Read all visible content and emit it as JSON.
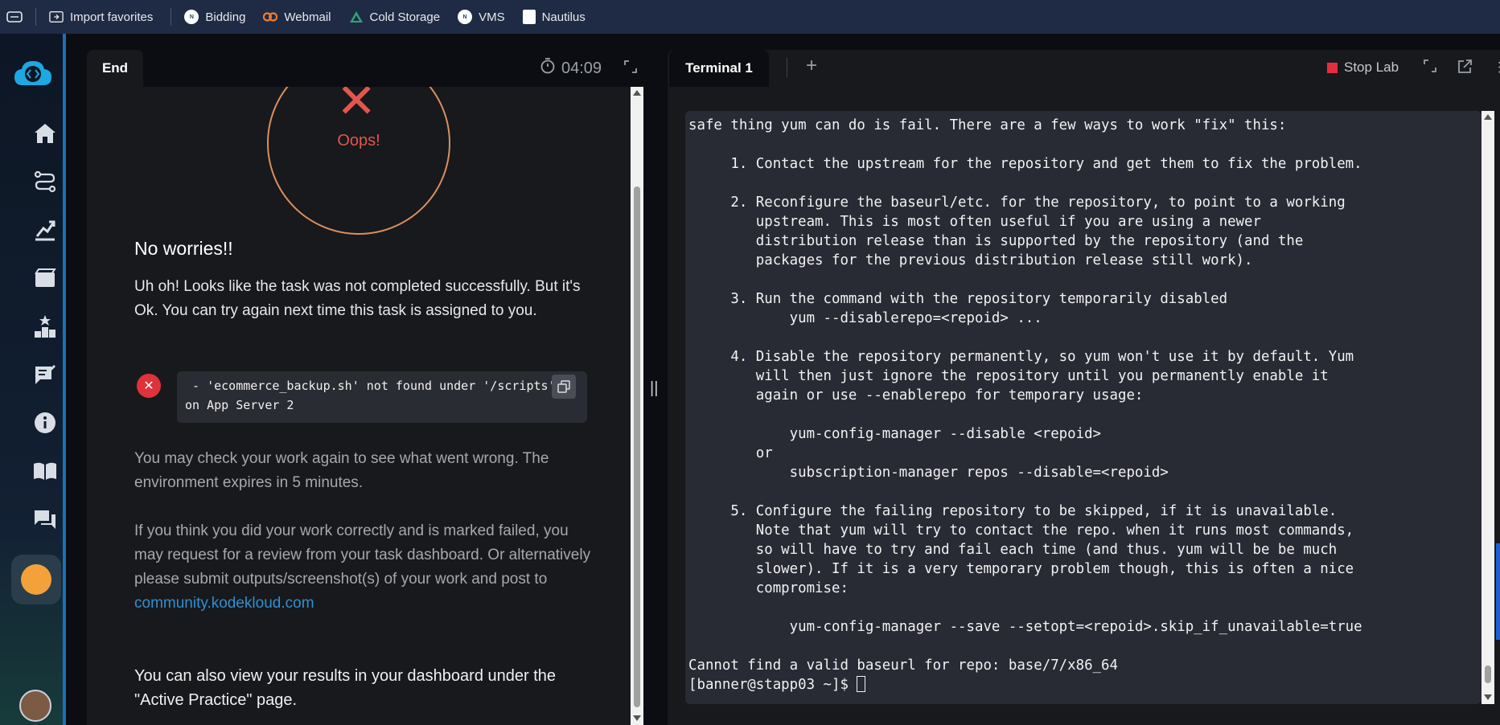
{
  "bookmarks": {
    "items": [
      {
        "label": "Import favorites",
        "icon": "folder-import-icon"
      },
      {
        "label": "Bidding",
        "icon": "nabl-icon"
      },
      {
        "label": "Webmail",
        "icon": "webmail-icon"
      },
      {
        "label": "Cold Storage",
        "icon": "triangle-icon"
      },
      {
        "label": "VMS",
        "icon": "nabl-icon"
      },
      {
        "label": "Nautilus",
        "icon": "page-icon"
      }
    ]
  },
  "left_panel": {
    "tab_label": "End",
    "timer": "04:09",
    "oops": "Oops!",
    "title": "No worries!!",
    "message": "Uh oh! Looks like the task was not completed successfully. But it's Ok. You can try again next time this task is assigned to you.",
    "error_line1": " - 'ecommerce_backup.sh' not found under '/scripts'",
    "error_line2": "on App Server 2",
    "check_again": "You may check your work again to see what went wrong. The environment expires in 5 minutes.",
    "review_text": "If you think you did your work correctly and is marked failed, you may request for a review from your task dashboard. Or alternatively please submit outputs/screenshot(s) of your work and post to ",
    "review_link": "community.kodekloud.com",
    "dashboard_text": "You can also view your results in your dashboard under the \"Active Practice\" page."
  },
  "right_panel": {
    "tab_label": "Terminal 1",
    "stop_label": "Stop Lab",
    "terminal_lines": [
      "safe thing yum can do is fail. There are a few ways to work \"fix\" this:",
      "",
      "     1. Contact the upstream for the repository and get them to fix the problem.",
      "",
      "     2. Reconfigure the baseurl/etc. for the repository, to point to a working",
      "        upstream. This is most often useful if you are using a newer",
      "        distribution release than is supported by the repository (and the",
      "        packages for the previous distribution release still work).",
      "",
      "     3. Run the command with the repository temporarily disabled",
      "            yum --disablerepo=<repoid> ...",
      "",
      "     4. Disable the repository permanently, so yum won't use it by default. Yum",
      "        will then just ignore the repository until you permanently enable it",
      "        again or use --enablerepo for temporary usage:",
      "",
      "            yum-config-manager --disable <repoid>",
      "        or",
      "            subscription-manager repos --disable=<repoid>",
      "",
      "     5. Configure the failing repository to be skipped, if it is unavailable.",
      "        Note that yum will try to contact the repo. when it runs most commands,",
      "        so will have to try and fail each time (and thus. yum will be be much",
      "        slower). If it is a very temporary problem though, this is often a nice",
      "        compromise:",
      "",
      "            yum-config-manager --save --setopt=<repoid>.skip_if_unavailable=true",
      "",
      "Cannot find a valid baseurl for repo: base/7/x86_64"
    ],
    "prompt": "[banner@stapp03 ~]$ "
  }
}
